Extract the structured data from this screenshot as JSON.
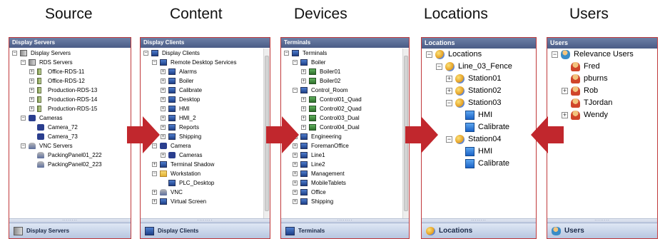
{
  "headings": [
    "Source",
    "Content",
    "Devices",
    "Locations",
    "Users"
  ],
  "colors": {
    "arrow": "#c1272d",
    "border": "#c0393b",
    "header": "#4a5c86"
  },
  "source": {
    "header": "Display Servers",
    "footer": "Display Servers",
    "tree": [
      {
        "label": "Display Servers",
        "level": 0,
        "exp": "-",
        "icon": "server"
      },
      {
        "label": "RDS Servers",
        "level": 1,
        "exp": "-",
        "icon": "server"
      },
      {
        "label": "Office-RDS-11",
        "level": 2,
        "exp": "+",
        "icon": "server-sm"
      },
      {
        "label": "Office-RDS-12",
        "level": 2,
        "exp": "+",
        "icon": "server-sm"
      },
      {
        "label": "Production-RDS-13",
        "level": 2,
        "exp": "+",
        "icon": "server-sm"
      },
      {
        "label": "Production-RDS-14",
        "level": 2,
        "exp": "+",
        "icon": "server-sm"
      },
      {
        "label": "Production-RDS-15",
        "level": 2,
        "exp": "+",
        "icon": "server-sm"
      },
      {
        "label": "Cameras",
        "level": 1,
        "exp": "-",
        "icon": "camera"
      },
      {
        "label": "Camera_72",
        "level": 2,
        "exp": "",
        "icon": "camera"
      },
      {
        "label": "Camera_73",
        "level": 2,
        "exp": "",
        "icon": "camera"
      },
      {
        "label": "VNC Servers",
        "level": 1,
        "exp": "-",
        "icon": "vnc"
      },
      {
        "label": "PackingPanel01_222",
        "level": 2,
        "exp": "",
        "icon": "vnc"
      },
      {
        "label": "PackingPanel02_223",
        "level": 2,
        "exp": "",
        "icon": "vnc"
      }
    ]
  },
  "content": {
    "header": "Display Clients",
    "footer": "Display Clients",
    "tree": [
      {
        "label": "Display Clients",
        "level": 0,
        "exp": "-",
        "icon": "monitor"
      },
      {
        "label": "Remote Desktop Services",
        "level": 1,
        "exp": "-",
        "icon": "monitor"
      },
      {
        "label": "Alarms",
        "level": 2,
        "exp": "+",
        "icon": "monitor"
      },
      {
        "label": "Boiler",
        "level": 2,
        "exp": "+",
        "icon": "monitor"
      },
      {
        "label": "Calibrate",
        "level": 2,
        "exp": "+",
        "icon": "monitor"
      },
      {
        "label": "Desktop",
        "level": 2,
        "exp": "+",
        "icon": "monitor"
      },
      {
        "label": "HMI",
        "level": 2,
        "exp": "+",
        "icon": "monitor"
      },
      {
        "label": "HMI_2",
        "level": 2,
        "exp": "+",
        "icon": "monitor"
      },
      {
        "label": "Reports",
        "level": 2,
        "exp": "+",
        "icon": "monitor"
      },
      {
        "label": "Shipping",
        "level": 2,
        "exp": "+",
        "icon": "monitor"
      },
      {
        "label": "Camera",
        "level": 1,
        "exp": "-",
        "icon": "camera"
      },
      {
        "label": "Cameras",
        "level": 2,
        "exp": "+",
        "icon": "camera"
      },
      {
        "label": "Terminal Shadow",
        "level": 1,
        "exp": "+",
        "icon": "monitor"
      },
      {
        "label": "Workstation",
        "level": 1,
        "exp": "-",
        "icon": "folder"
      },
      {
        "label": "PLC_Desktop",
        "level": 2,
        "exp": "",
        "icon": "monitor"
      },
      {
        "label": "VNC",
        "level": 1,
        "exp": "+",
        "icon": "vnc"
      },
      {
        "label": "Virtual Screen",
        "level": 1,
        "exp": "+",
        "icon": "monitor"
      }
    ]
  },
  "devices": {
    "header": "Terminals",
    "footer": "Terminals",
    "tree": [
      {
        "label": "Terminals",
        "level": 0,
        "exp": "-",
        "icon": "monitor"
      },
      {
        "label": "Boiler",
        "level": 1,
        "exp": "-",
        "icon": "monitor"
      },
      {
        "label": "Boiler01",
        "level": 2,
        "exp": "+",
        "icon": "monitor-green"
      },
      {
        "label": "Boiler02",
        "level": 2,
        "exp": "+",
        "icon": "monitor-green"
      },
      {
        "label": "Control_Room",
        "level": 1,
        "exp": "-",
        "icon": "monitor"
      },
      {
        "label": "Control01_Quad",
        "level": 2,
        "exp": "+",
        "icon": "monitor-green"
      },
      {
        "label": "Control02_Quad",
        "level": 2,
        "exp": "+",
        "icon": "monitor-green"
      },
      {
        "label": "Control03_Dual",
        "level": 2,
        "exp": "+",
        "icon": "monitor-green"
      },
      {
        "label": "Control04_Dual",
        "level": 2,
        "exp": "+",
        "icon": "monitor-green"
      },
      {
        "label": "Engineering",
        "level": 1,
        "exp": "+",
        "icon": "monitor"
      },
      {
        "label": "ForemanOffice",
        "level": 1,
        "exp": "+",
        "icon": "monitor"
      },
      {
        "label": "Line1",
        "level": 1,
        "exp": "+",
        "icon": "monitor"
      },
      {
        "label": "Line2",
        "level": 1,
        "exp": "+",
        "icon": "monitor"
      },
      {
        "label": "Management",
        "level": 1,
        "exp": "+",
        "icon": "monitor"
      },
      {
        "label": "MobileTablets",
        "level": 1,
        "exp": "+",
        "icon": "monitor"
      },
      {
        "label": "Office",
        "level": 1,
        "exp": "+",
        "icon": "monitor"
      },
      {
        "label": "Shipping",
        "level": 1,
        "exp": "+",
        "icon": "monitor"
      }
    ]
  },
  "locations": {
    "header": "Locations",
    "footer": "Locations",
    "tree": [
      {
        "label": "Locations",
        "level": 0,
        "exp": "-",
        "icon": "globe"
      },
      {
        "label": "Line_03_Fence",
        "level": 1,
        "exp": "-",
        "icon": "globe"
      },
      {
        "label": "Station01",
        "level": 2,
        "exp": "+",
        "icon": "globe"
      },
      {
        "label": "Station02",
        "level": 2,
        "exp": "+",
        "icon": "globe"
      },
      {
        "label": "Station03",
        "level": 2,
        "exp": "-",
        "icon": "globe"
      },
      {
        "label": "HMI",
        "level": 3,
        "exp": "",
        "icon": "screen"
      },
      {
        "label": "Calibrate",
        "level": 3,
        "exp": "",
        "icon": "screen"
      },
      {
        "label": "Station04",
        "level": 2,
        "exp": "-",
        "icon": "globe"
      },
      {
        "label": "HMI",
        "level": 3,
        "exp": "",
        "icon": "screen"
      },
      {
        "label": "Calibrate",
        "level": 3,
        "exp": "",
        "icon": "screen"
      }
    ]
  },
  "users": {
    "header": "Users",
    "footer": "Users",
    "tree": [
      {
        "label": "Relevance Users",
        "level": 0,
        "exp": "-",
        "icon": "users"
      },
      {
        "label": "Fred",
        "level": 1,
        "exp": "",
        "icon": "user"
      },
      {
        "label": "pburns",
        "level": 1,
        "exp": "",
        "icon": "user"
      },
      {
        "label": "Rob",
        "level": 1,
        "exp": "+",
        "icon": "user"
      },
      {
        "label": "TJordan",
        "level": 1,
        "exp": "",
        "icon": "user"
      },
      {
        "label": "Wendy",
        "level": 1,
        "exp": "+",
        "icon": "user"
      }
    ]
  }
}
